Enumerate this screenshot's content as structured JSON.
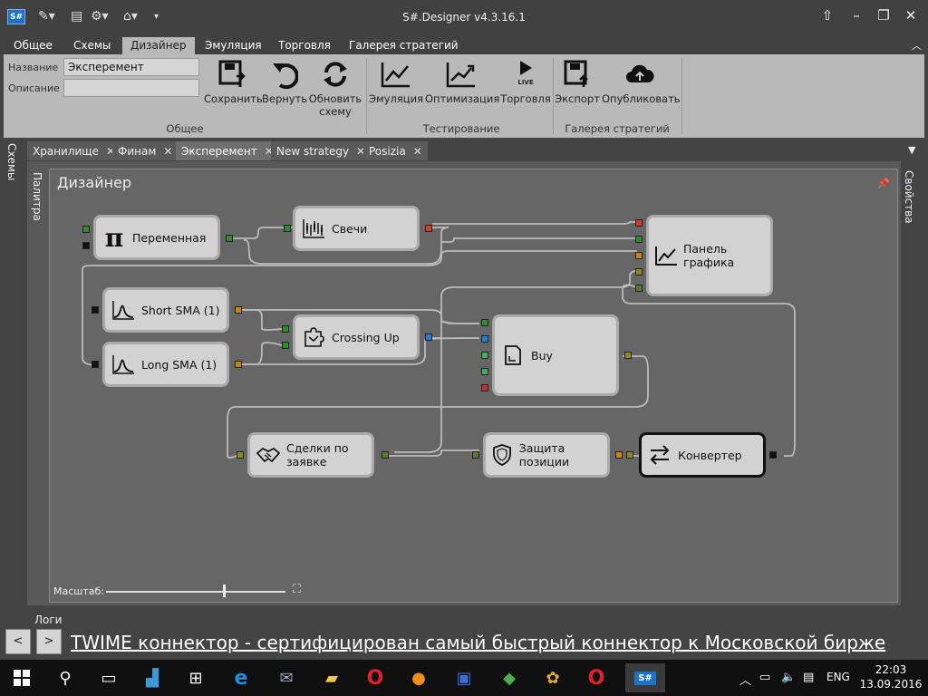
{
  "window": {
    "title": "S#.Designer v4.3.16.1",
    "logo": "S#"
  },
  "menu": {
    "tabs": [
      "Общее",
      "Схемы",
      "Дизайнер",
      "Эмуляция",
      "Торговля",
      "Галерея стратегий"
    ],
    "active": "Дизайнер"
  },
  "ribbon": {
    "name_label": "Название",
    "name_value": "Эксперемент",
    "desc_label": "Описание",
    "desc_value": "",
    "buttons": {
      "save": "Сохранить",
      "revert": "Вернуть",
      "refresh": "Обновить схему",
      "emulation": "Эмуляция",
      "optimization": "Оптимизация",
      "trading": "Торговля",
      "export": "Экспорт",
      "publish": "Опубликовать"
    },
    "trading_badge": "LIVE",
    "groups": {
      "general": "Общее",
      "testing": "Тестирование",
      "gallery": "Галерея стратегий"
    }
  },
  "doc_tabs": [
    "Хранилище",
    "Финам",
    "Эксперемент",
    "New strategy",
    "Posizia"
  ],
  "active_doc_tab": "Эксперемент",
  "side": {
    "schemes": "Схемы",
    "palette": "Палитра",
    "properties": "Свойства"
  },
  "designer": {
    "title": "Дизайнер",
    "scale_label": "Масштаб:",
    "zoom_level": 0.65,
    "nodes": {
      "variable": "Переменная",
      "candles": "Свечи",
      "chart": "Панель графика",
      "short_sma": "Short SMA (1)",
      "long_sma": "Long SMA (1)",
      "crossing": "Crossing Up",
      "buy": "Buy",
      "trades": "Сделки по заявке",
      "protect": "Защита позиции",
      "converter": "Конвертер"
    }
  },
  "logs": {
    "label": "Логи",
    "prev": "<",
    "next": ">",
    "ticker": "TWIME коннектор - сертифицирован самый быстрый коннектор к Московской бирже"
  },
  "taskbar": {
    "lang": "ENG",
    "time": "22:03",
    "date": "13.09.2016"
  },
  "colors": {
    "port_green": "#2e8b2e",
    "port_orange": "#c8860a",
    "port_red": "#e03a20",
    "port_blue": "#1e7fe0",
    "port_black": "#111111"
  }
}
